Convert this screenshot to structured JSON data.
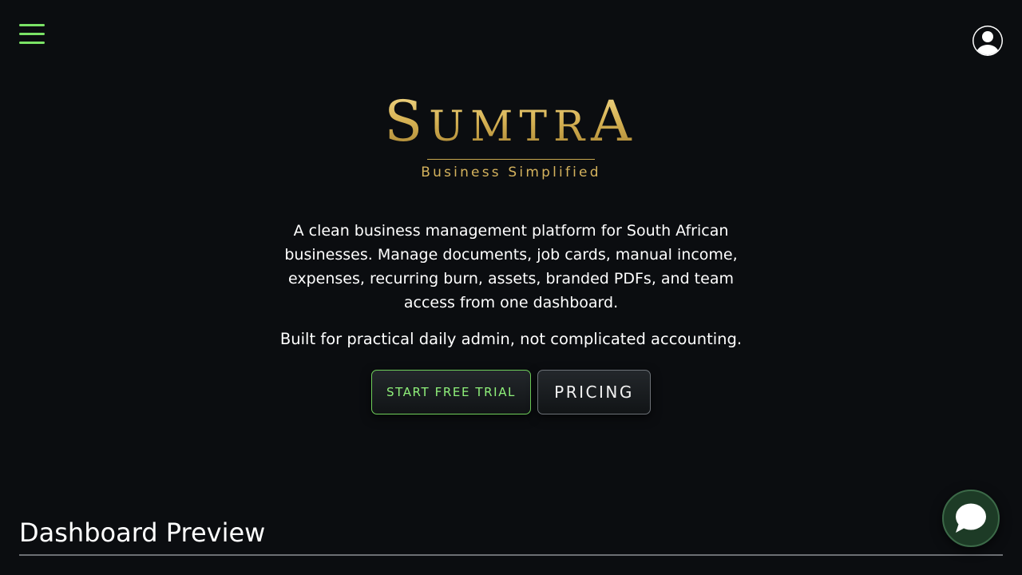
{
  "header": {
    "menu_icon": "hamburger-menu-icon",
    "account_icon": "user-circle-icon"
  },
  "logo": {
    "wordmark": "SUMTRA",
    "tagline": "Business Simplified"
  },
  "hero": {
    "description": "A clean business management platform for South African businesses. Manage documents, job cards, manual income, expenses, recurring burn, assets, branded PDFs, and team access from one dashboard.",
    "subline": "Built for practical daily admin, not complicated accounting."
  },
  "cta": {
    "trial_label": "START FREE TRIAL",
    "pricing_label": "PRICING"
  },
  "preview": {
    "title": "Dashboard Preview"
  },
  "chat": {
    "icon": "chat-bubble-icon"
  },
  "colors": {
    "background": "#0b0d10",
    "accent_green": "#7be366",
    "gold": "#d4b25d"
  }
}
